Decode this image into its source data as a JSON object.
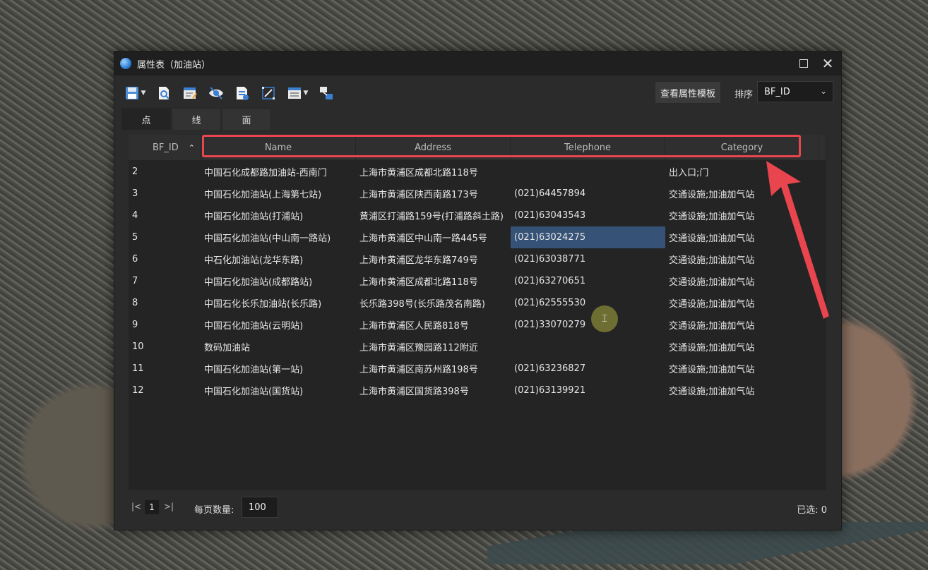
{
  "window": {
    "title": "属性表（加油站）",
    "maximize_icon": "maximize-icon",
    "close_icon": "close-icon",
    "close_glyph": "✕"
  },
  "toolbar": {
    "buttons": [
      "save-icon",
      "zoom-to-icon",
      "edit-table-icon",
      "visibility-icon",
      "export-icon",
      "select-edit-icon",
      "field-list-icon",
      "link-icon"
    ],
    "view_template_label": "查看属性模板",
    "sort_label": "排序",
    "sort_value": "BF_ID"
  },
  "tabs": [
    "点",
    "线",
    "面"
  ],
  "table": {
    "headers": [
      "BF_ID",
      "Name",
      "Address",
      "Telephone",
      "Category"
    ],
    "rows": [
      [
        "2",
        "中国石化成都路加油站-西南门",
        "上海市黄浦区成都北路118号",
        "",
        "出入口;门"
      ],
      [
        "3",
        "中国石化加油站(上海第七站)",
        "上海市黄浦区陕西南路173号",
        "(021)64457894",
        "交通设施;加油加气站"
      ],
      [
        "4",
        "中国石化加油站(打浦站)",
        "黄浦区打浦路159号(打浦路斜土路)",
        "(021)63043543",
        "交通设施;加油加气站"
      ],
      [
        "5",
        "中国石化加油站(中山南一路站)",
        "上海市黄浦区中山南一路445号",
        "(021)63024275",
        "交通设施;加油加气站"
      ],
      [
        "6",
        "中石化加油站(龙华东路)",
        "上海市黄浦区龙华东路749号",
        "(021)63038771",
        "交通设施;加油加气站"
      ],
      [
        "7",
        "中国石化加油站(成都路站)",
        "上海市黄浦区成都北路118号",
        "(021)63270651",
        "交通设施;加油加气站"
      ],
      [
        "8",
        "中国石化长乐加油站(长乐路)",
        "长乐路398号(长乐路茂名南路)",
        "(021)62555530",
        "交通设施;加油加气站"
      ],
      [
        "9",
        "中国石化加油站(云明站)",
        "上海市黄浦区人民路818号",
        "(021)33070279",
        "交通设施;加油加气站"
      ],
      [
        "10",
        "数码加油站",
        "上海市黄浦区豫园路112附近",
        "",
        "交通设施;加油加气站"
      ],
      [
        "11",
        "中国石化加油站(第一站)",
        "上海市黄浦区南苏州路198号",
        "(021)63236827",
        "交通设施;加油加气站"
      ],
      [
        "12",
        "中国石化加油站(国货站)",
        "上海市黄浦区国货路398号",
        "(021)63139921",
        "交通设施;加油加气站"
      ]
    ],
    "selected_cell": {
      "row": 3,
      "col": 3
    }
  },
  "colors": {
    "highlight": "#e8454e",
    "selection": "#365277",
    "window_bg": "#2b2b2b"
  },
  "footer": {
    "first_page_glyph": "|<",
    "page": "1",
    "last_page_glyph": ">|",
    "per_page_label": "每页数量:",
    "per_page_value": "100",
    "selected_label": "已选: 0"
  }
}
